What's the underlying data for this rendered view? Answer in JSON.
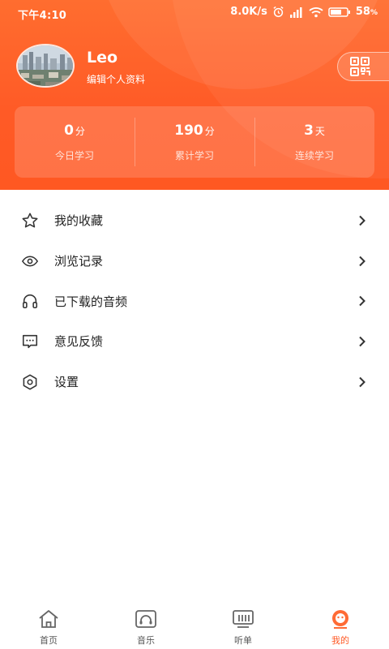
{
  "status_bar": {
    "time": "下午4:10",
    "network_speed": "8.0K/s",
    "battery": "58",
    "battery_unit": "%"
  },
  "profile": {
    "name": "Leo",
    "edit_label": "编辑个人资料"
  },
  "stats": [
    {
      "value": "0",
      "unit": "分",
      "label": "今日学习"
    },
    {
      "value": "190",
      "unit": "分",
      "label": "累计学习"
    },
    {
      "value": "3",
      "unit": "天",
      "label": "连续学习"
    }
  ],
  "menu": [
    {
      "label": "我的收藏",
      "icon": "star-icon"
    },
    {
      "label": "浏览记录",
      "icon": "eye-icon"
    },
    {
      "label": "已下载的音频",
      "icon": "headphones-icon"
    },
    {
      "label": "意见反馈",
      "icon": "feedback-icon"
    },
    {
      "label": "设置",
      "icon": "settings-icon"
    }
  ],
  "bottom_nav": [
    {
      "label": "首页",
      "icon": "home-icon"
    },
    {
      "label": "音乐",
      "icon": "music-icon"
    },
    {
      "label": "听单",
      "icon": "playlist-icon"
    },
    {
      "label": "我的",
      "icon": "profile-icon",
      "active": true
    }
  ],
  "colors": {
    "accent": "#ff5a26",
    "header_top": "#ff6d2f"
  }
}
